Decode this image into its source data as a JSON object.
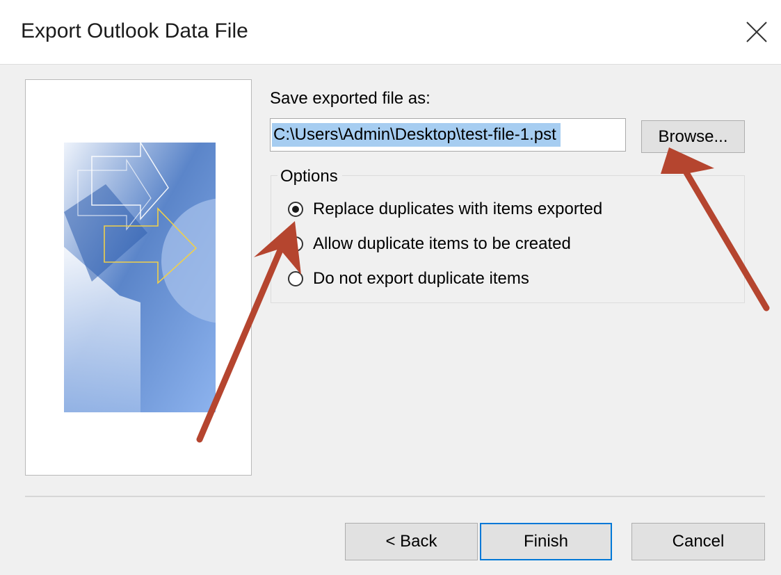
{
  "window": {
    "title": "Export Outlook Data File",
    "close_icon": "close-icon"
  },
  "form": {
    "save_label": "Save exported file as:",
    "file_path": "C:\\Users\\Admin\\Desktop\\test-file-1.pst",
    "browse_label": "Browse...",
    "options_label": "Options",
    "options": [
      {
        "label": "Replace duplicates with items exported",
        "selected": true
      },
      {
        "label": "Allow duplicate items to be created",
        "selected": false
      },
      {
        "label": "Do not export duplicate items",
        "selected": false
      }
    ]
  },
  "footer": {
    "back_label": "< Back",
    "finish_label": "Finish",
    "cancel_label": "Cancel"
  },
  "colors": {
    "annotation_arrow": "#b5452f",
    "default_button_border": "#0078d7",
    "selection_highlight": "#a6cdf1"
  }
}
